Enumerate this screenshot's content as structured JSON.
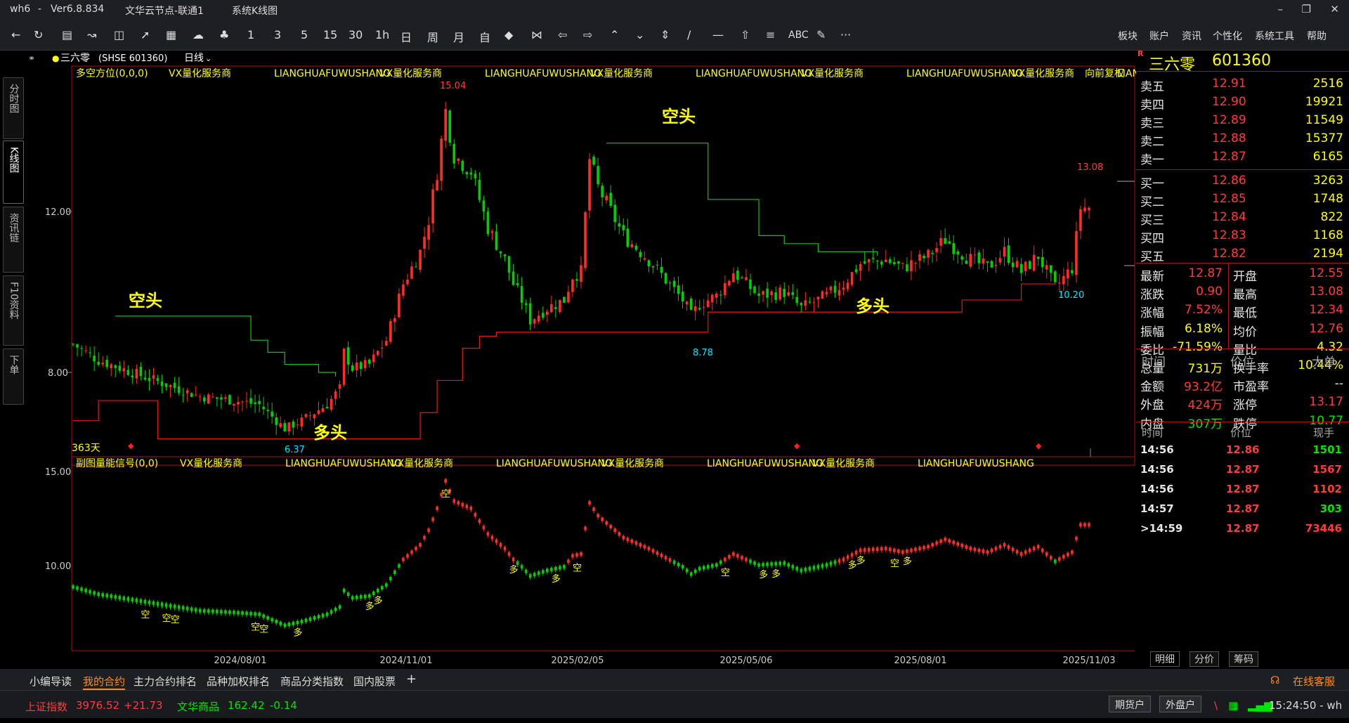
{
  "window": {
    "app": "wh6",
    "dash": "-",
    "version": "Ver6.8.834",
    "server": "文华云节点-联通1",
    "view": "系统K线图"
  },
  "toolbar": {
    "periods": [
      "1",
      "3",
      "5",
      "15",
      "30",
      "1h",
      "日",
      "周",
      "月",
      "自"
    ],
    "menus": [
      "板块",
      "账户",
      "资讯",
      "个性化",
      "系统工具",
      "帮助"
    ],
    "abc_label": "ABC",
    "more_label": "···"
  },
  "left_tabs": [
    "分时图",
    "K线图",
    "资讯链",
    "F10资料",
    "下单"
  ],
  "chart_header": {
    "name": "三六零",
    "code": "(SHSE 601360)",
    "period": "日线"
  },
  "main_indicator": {
    "title": "多空方位(0,0,0)",
    "ads": [
      "VX量化服务商",
      "LIANGHUAFUWUSHANG",
      "VX量化服务商",
      "LIANGHUAFUWUSHANG",
      "VX量化服务商",
      "LIANGHUAFUWUSHANG",
      "VX量化服务商",
      "LIANGHUAFUWUSHANG",
      "VX量化服务商",
      "LIANGHUAFUWUSHANG"
    ],
    "adjust": "向前复权",
    "days_label": "363天",
    "annotations": {
      "kong1": "空头",
      "kong2": "空头",
      "duo1": "多头",
      "duo2": "多头",
      "high": "15.04",
      "low1": "6.37",
      "low2": "8.78",
      "low3": "10.20",
      "last_high": "13.08"
    }
  },
  "sub_indicator": {
    "title": "副图量能信号(0,0)",
    "ads": [
      "VX量化服务商",
      "LIANGHUAFUWUSHANG",
      "VX量化服务商",
      "LIANGHUAFUWUSHANG",
      "VX量化服务商",
      "LIANGHUAFUWUSHANG",
      "VX量化服务商",
      "LIANGHUAFUWUSHANG"
    ],
    "duo": "多",
    "kong": "空"
  },
  "chart_data": {
    "type": "candlestick",
    "y_axis_main": {
      "ticks": [
        "12.00",
        "8.00"
      ],
      "range": [
        6.0,
        15.5
      ]
    },
    "y_axis_sub": {
      "ticks": [
        "15.00",
        "10.00"
      ]
    },
    "x_labels": [
      "2024/08/01",
      "2024/11/01",
      "2025/02/05",
      "2025/05/06",
      "2025/08/01",
      "2025/11/03"
    ],
    "close_path": [
      [
        0,
        8.7
      ],
      [
        6,
        8.3
      ],
      [
        14,
        8.0
      ],
      [
        22,
        7.7
      ],
      [
        30,
        7.4
      ],
      [
        38,
        7.3
      ],
      [
        44,
        7.2
      ],
      [
        50,
        6.6
      ],
      [
        54,
        6.8
      ],
      [
        60,
        7.2
      ],
      [
        63,
        7.6
      ],
      [
        64,
        8.5
      ],
      [
        66,
        8.1
      ],
      [
        70,
        8.2
      ],
      [
        74,
        8.8
      ],
      [
        78,
        10.2
      ],
      [
        82,
        11.0
      ],
      [
        84,
        11.8
      ],
      [
        86,
        13.0
      ],
      [
        88,
        14.5
      ],
      [
        90,
        13.4
      ],
      [
        94,
        13.0
      ],
      [
        98,
        11.6
      ],
      [
        102,
        10.8
      ],
      [
        104,
        10.2
      ],
      [
        106,
        9.8
      ],
      [
        108,
        9.3
      ],
      [
        112,
        9.6
      ],
      [
        116,
        9.8
      ],
      [
        118,
        10.4
      ],
      [
        120,
        10.5
      ],
      [
        122,
        13.3
      ],
      [
        124,
        12.6
      ],
      [
        126,
        12.2
      ],
      [
        130,
        11.4
      ],
      [
        136,
        10.8
      ],
      [
        140,
        10.3
      ],
      [
        144,
        9.8
      ],
      [
        146,
        9.4
      ],
      [
        148,
        9.7
      ],
      [
        152,
        9.9
      ],
      [
        156,
        10.5
      ],
      [
        162,
        9.9
      ],
      [
        168,
        10.0
      ],
      [
        172,
        9.6
      ],
      [
        178,
        9.9
      ],
      [
        182,
        10.2
      ],
      [
        186,
        10.7
      ],
      [
        192,
        10.8
      ],
      [
        196,
        10.6
      ],
      [
        202,
        10.9
      ],
      [
        206,
        11.3
      ],
      [
        212,
        10.8
      ],
      [
        216,
        10.6
      ],
      [
        220,
        11.0
      ],
      [
        224,
        10.5
      ],
      [
        228,
        10.9
      ],
      [
        232,
        10.1
      ],
      [
        236,
        10.6
      ],
      [
        238,
        12.1
      ]
    ],
    "long_support": [
      [
        0,
        6.8
      ],
      [
        6,
        7.3
      ],
      [
        16,
        7.3
      ],
      [
        20,
        6.35
      ],
      [
        64,
        6.35
      ],
      [
        76,
        6.35
      ],
      [
        82,
        7.0
      ],
      [
        86,
        7.8
      ],
      [
        92,
        8.6
      ],
      [
        96,
        8.9
      ],
      [
        100,
        9.0
      ],
      [
        114,
        9.0
      ],
      [
        134,
        9.0
      ],
      [
        150,
        9.5
      ],
      [
        180,
        9.5
      ],
      [
        200,
        9.5
      ],
      [
        210,
        9.8
      ],
      [
        224,
        10.2
      ],
      [
        232,
        10.2
      ]
    ],
    "short_resist": [
      [
        10,
        9.4
      ],
      [
        40,
        9.4
      ],
      [
        42,
        8.8
      ],
      [
        46,
        8.5
      ],
      [
        50,
        8.2
      ],
      [
        58,
        8.0
      ],
      [
        62,
        7.9
      ],
      [
        126,
        13.7
      ],
      [
        144,
        13.7
      ],
      [
        150,
        12.3
      ],
      [
        162,
        11.4
      ],
      [
        168,
        11.2
      ],
      [
        176,
        11.0
      ],
      [
        190,
        10.9
      ]
    ],
    "depth": {
      "asks": [
        {
          "label": "卖五",
          "price": "12.91",
          "vol": "2516"
        },
        {
          "label": "卖四",
          "price": "12.90",
          "vol": "19921"
        },
        {
          "label": "卖三",
          "price": "12.89",
          "vol": "11549"
        },
        {
          "label": "卖二",
          "price": "12.88",
          "vol": "15377"
        },
        {
          "label": "卖一",
          "price": "12.87",
          "vol": "6165"
        }
      ],
      "bids": [
        {
          "label": "买一",
          "price": "12.86",
          "vol": "3263"
        },
        {
          "label": "买二",
          "price": "12.85",
          "vol": "1748"
        },
        {
          "label": "买三",
          "price": "12.84",
          "vol": "822"
        },
        {
          "label": "买四",
          "price": "12.83",
          "vol": "1168"
        },
        {
          "label": "买五",
          "price": "12.82",
          "vol": "2194"
        }
      ]
    }
  },
  "quote": {
    "title_name": "三六零",
    "title_code": "601360",
    "stats": [
      {
        "l": "最新",
        "lv": "12.87",
        "lc": "red",
        "r": "开盘",
        "rv": "12.55",
        "rc": "red"
      },
      {
        "l": "涨跌",
        "lv": "0.90",
        "lc": "red",
        "r": "最高",
        "rv": "13.08",
        "rc": "red"
      },
      {
        "l": "涨幅",
        "lv": "7.52%",
        "lc": "red",
        "r": "最低",
        "rv": "12.34",
        "rc": "red"
      },
      {
        "l": "振幅",
        "lv": "6.18%",
        "lc": "yellow",
        "r": "均价",
        "rv": "12.76",
        "rc": "red"
      },
      {
        "l": "委比",
        "lv": "-71.59%",
        "lc": "yellow",
        "r": "量比",
        "rv": "4.32",
        "rc": "yellow"
      },
      {
        "l": "总量",
        "lv": "731万",
        "lc": "yellow",
        "r": "换手率",
        "rv": "10.44%",
        "rc": "yellow"
      },
      {
        "l": "金额",
        "lv": "93.2亿",
        "lc": "red",
        "r": "市盈率",
        "rv": "--",
        "rc": "white"
      },
      {
        "l": "外盘",
        "lv": "424万",
        "lc": "red",
        "r": "涨停",
        "rv": "13.17",
        "rc": "red"
      },
      {
        "l": "内盘",
        "lv": "307万",
        "lc": "green",
        "r": "跌停",
        "rv": "10.77",
        "rc": "green"
      }
    ],
    "tick_header1": {
      "time": "时间",
      "price": "价位",
      "big": "大单"
    },
    "tick_header2": {
      "time": "时间",
      "price": "价位",
      "vol": "现手"
    },
    "ticks": [
      {
        "t": "14:56",
        "p": "12.86",
        "v": "1501",
        "vc": "green"
      },
      {
        "t": "14:56",
        "p": "12.87",
        "v": "1567",
        "vc": "red"
      },
      {
        "t": "14:56",
        "p": "12.87",
        "v": "1102",
        "vc": "red"
      },
      {
        "t": "14:57",
        "p": "12.87",
        "v": "303",
        "vc": "green"
      },
      {
        "t": ">14:59",
        "p": "12.87",
        "v": "73446",
        "vc": "red"
      }
    ],
    "subtabs": [
      "明细",
      "分价",
      "筹码"
    ]
  },
  "bottom_tabs": [
    "小编导读",
    "我的合约",
    "主力合约排名",
    "品种加权排名",
    "商品分类指数",
    "国内股票",
    "+"
  ],
  "service": "在线客服",
  "status": {
    "idx1_name": "上证指数",
    "idx1_val": "3976.52",
    "idx1_chg": "+21.73",
    "idx2_name": "文华商品",
    "idx2_val": "162.42",
    "idx2_chg": "-0.14",
    "btn1": "期货户",
    "btn2": "外盘户",
    "clock": "15:24:50 - wh"
  }
}
